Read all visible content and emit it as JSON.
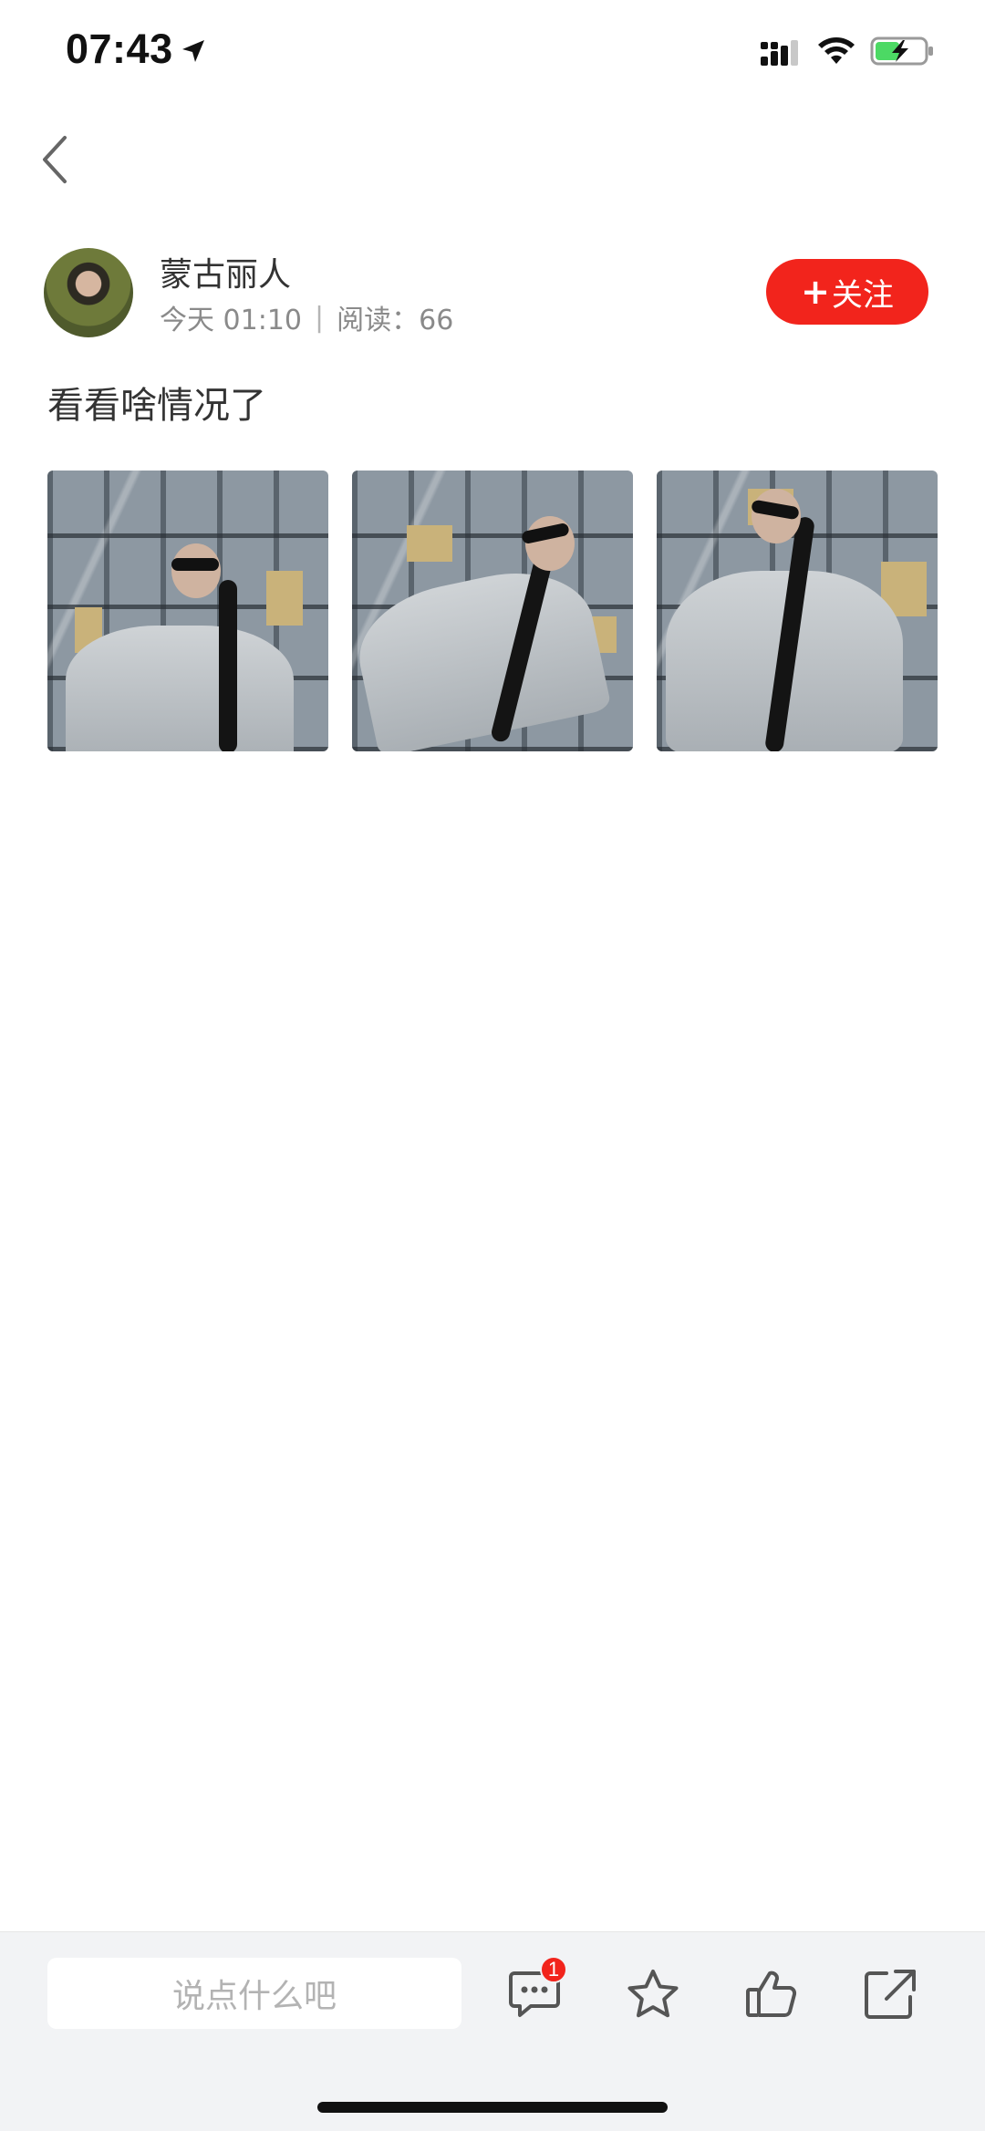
{
  "status_bar": {
    "time": "07:43"
  },
  "nav": {
    "back_icon": "chevron-left-icon"
  },
  "author": {
    "name": "蒙古丽人",
    "date": "今天 01:10",
    "separator": "|",
    "reads_label": "阅读：66",
    "follow_label": "关注",
    "follow_prefix": "+"
  },
  "post": {
    "text": "看看啥情况了",
    "images": [
      "photo-1",
      "photo-2",
      "photo-3"
    ]
  },
  "bottom_bar": {
    "comment_placeholder": "说点什么吧",
    "comment_count": "1",
    "icons": [
      "comment-icon",
      "star-icon",
      "thumbs-up-icon",
      "share-icon"
    ]
  },
  "colors": {
    "accent": "#f2241c",
    "bar_background": "#f2f3f5",
    "meta_text": "#8a8a8a"
  }
}
